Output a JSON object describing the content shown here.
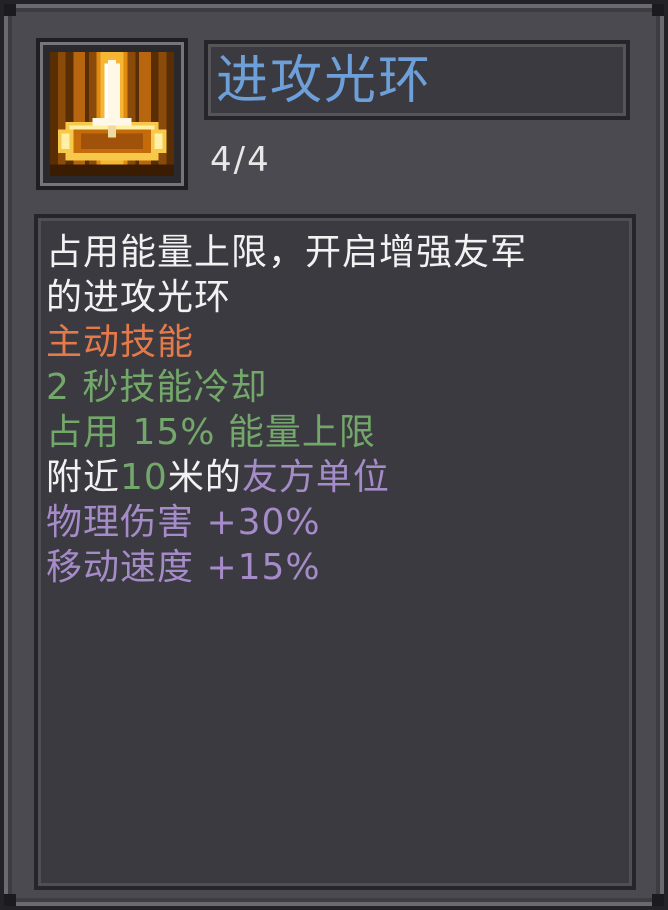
{
  "skill": {
    "name": "进攻光环",
    "level": "4/4",
    "icon": "sword-aura-icon"
  },
  "description": {
    "line1": "占用能量上限，开启增强友军",
    "line2": "的进攻光环",
    "type_label": "主动技能",
    "cooldown": "2 秒技能冷却",
    "cost": "占用 15% 能量上限",
    "range_prefix": "附近",
    "range_value": "10",
    "range_mid": "米的",
    "range_target": "友方单位",
    "stat1": "物理伤害 +30%",
    "stat2": "移动速度 +15%"
  },
  "colors": {
    "title": "#6d9fd8",
    "text": "#f2f2f2",
    "skill_type": "#e4794a",
    "positive": "#73a86a",
    "stat": "#a68bc9",
    "panel": "#4a4a50"
  }
}
